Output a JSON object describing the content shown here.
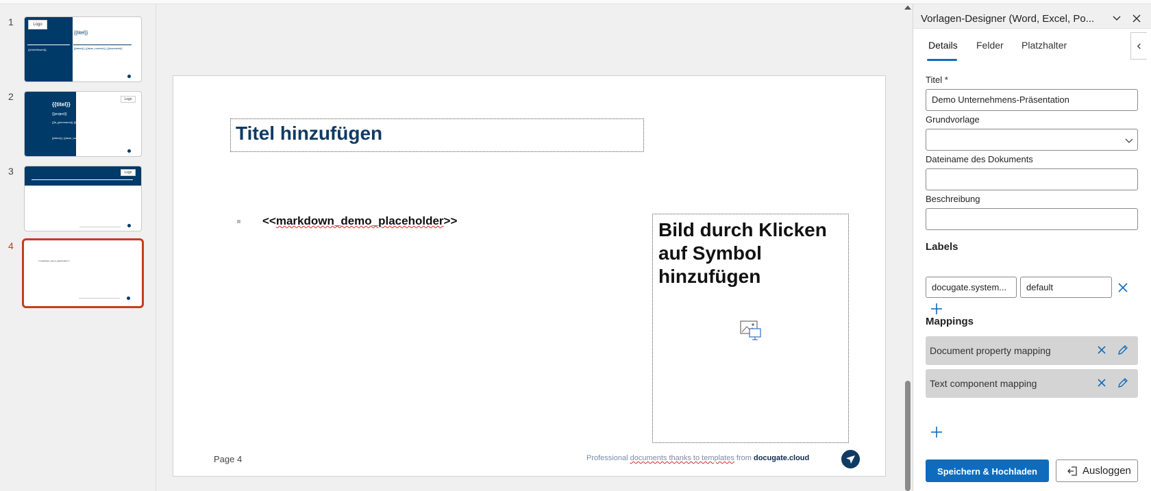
{
  "thumbnails": [
    {
      "number": "1",
      "logo": "Logo",
      "title": "{{titel}}",
      "left_text": "{{einheitswert}}",
      "meta": "{{datum}} | {{dauer_nummer}} | {{documente}}"
    },
    {
      "number": "2",
      "logo": "Logo",
      "title": "{{titel}}",
      "project": "{{project}}",
      "names": "{{fa_givenname}} {{fa_surname}}",
      "meta": "{{datum}} | {{dauer_nummer}} | {{documente}}"
    },
    {
      "number": "3",
      "logo": "Logo"
    },
    {
      "number": "4",
      "line": "<<markdown_demo_placeholder>>"
    }
  ],
  "slide": {
    "title_placeholder": "Titel hinzufügen",
    "content_prefix": "<<",
    "content_word": "markdown_demo_placeholder",
    "content_suffix": ">>",
    "image_placeholder": "Bild durch Klicken auf Symbol hinzufügen",
    "page_label": "Page 4",
    "footer_prefix": "Professional ",
    "footer_squiggle": "documents thanks to templates",
    "footer_mid": " from ",
    "footer_brand": "docugate.cloud"
  },
  "pane": {
    "title": "Vorlagen-Designer (Word, Excel, Po...",
    "tabs": [
      "Details",
      "Felder",
      "Platzhalter"
    ],
    "fields": {
      "titel_label": "Titel *",
      "titel_value": "Demo Unternehmens-Präsentation",
      "grundvorlage_label": "Grundvorlage",
      "grundvorlage_value": "",
      "dateiname_label": "Dateiname des Dokuments",
      "dateiname_value": "",
      "beschreibung_label": "Beschreibung",
      "beschreibung_value": ""
    },
    "labels_heading": "Labels",
    "label_key": "docugate.system...",
    "label_value": "default",
    "mappings_heading": "Mappings",
    "mappings": [
      "Document property mapping",
      "Text component mapping"
    ],
    "save_button": "Speichern & Hochladen",
    "logout_button": "Ausloggen"
  },
  "colors": {
    "accent": "#0f6cbd",
    "slide_navy": "#003a68",
    "active_thumb": "#c43e1c"
  }
}
